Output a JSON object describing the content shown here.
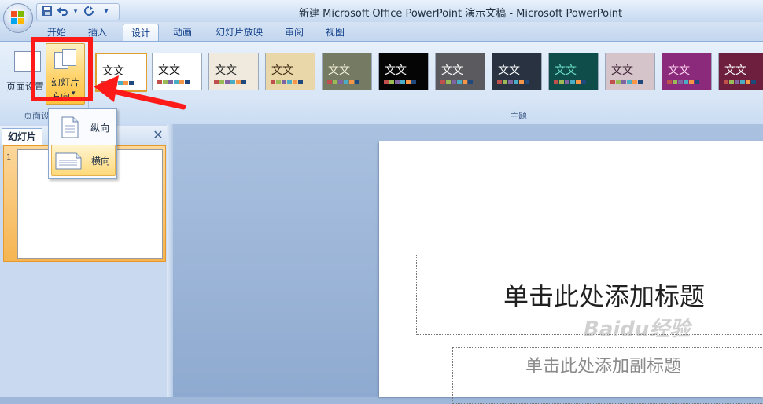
{
  "window": {
    "title": "新建 Microsoft Office PowerPoint 演示文稿 - Microsoft PowerPoint"
  },
  "quick_access": {
    "icons": [
      "save-icon",
      "undo-icon",
      "dropdown-icon",
      "redo-icon",
      "customize-icon"
    ]
  },
  "tabs": [
    {
      "label": "开始"
    },
    {
      "label": "插入"
    },
    {
      "label": "设计",
      "active": true
    },
    {
      "label": "动画"
    },
    {
      "label": "幻灯片放映"
    },
    {
      "label": "审阅"
    },
    {
      "label": "视图"
    }
  ],
  "ribbon": {
    "page_setup_group": {
      "label": "页面设置",
      "page_setup_button": "页面设置",
      "orientation_button_line1": "幻灯片",
      "orientation_button_line2": "方向",
      "orientation_arrow": "▾"
    },
    "themes_group": {
      "label": "主题",
      "themes": [
        {
          "text": "文文",
          "bg": "#ffffff",
          "fg": "#111111",
          "border": "#e0a030"
        },
        {
          "text": "文文",
          "bg": "#ffffff",
          "fg": "#111111"
        },
        {
          "text": "文文",
          "bg": "#efeadd",
          "fg": "#222222"
        },
        {
          "text": "文文",
          "bg": "#e9d6a9",
          "fg": "#3a2a10"
        },
        {
          "text": "文文",
          "bg": "#757a63",
          "fg": "#f2f0d6"
        },
        {
          "text": "文文",
          "bg": "#050505",
          "fg": "#ffffff"
        },
        {
          "text": "文文",
          "bg": "#5a5a5f",
          "fg": "#ffffff"
        },
        {
          "text": "文文",
          "bg": "#293241",
          "fg": "#ffffff"
        },
        {
          "text": "文文",
          "bg": "#0e4d49",
          "fg": "#6fe0c8"
        },
        {
          "text": "文文",
          "bg": "#d5c4c9",
          "fg": "#3a2030"
        },
        {
          "text": "文文",
          "bg": "#8b2a7a",
          "fg": "#ffd7f3"
        },
        {
          "text": "文文",
          "bg": "#6e1f3d",
          "fg": "#ffffff"
        }
      ]
    }
  },
  "orientation_menu": {
    "items": [
      {
        "label": "纵向",
        "icon": "portrait-page-icon"
      },
      {
        "label": "横向",
        "icon": "landscape-page-icon",
        "highlighted": true
      }
    ]
  },
  "left_pane": {
    "tab_label": "幻灯片",
    "close_glyph": "✕",
    "slide_number": "1"
  },
  "slide": {
    "title_placeholder": "单击此处添加标题",
    "subtitle_placeholder": "单击此处添加副标题"
  },
  "watermark": {
    "text": "Baidu经验"
  },
  "colors": {
    "annotation_red": "#ff1a1a",
    "accent_blue": "#15428b",
    "highlight_orange": "#ffd97a"
  }
}
